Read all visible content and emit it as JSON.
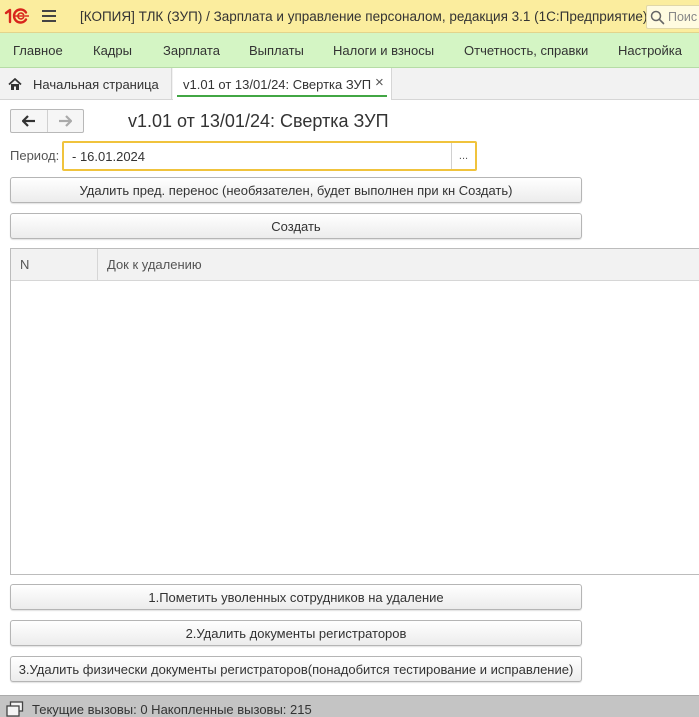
{
  "titlebar": {
    "title": "[КОПИЯ] ТЛК (ЗУП) / Зарплата и управление персоналом, редакция 3.1  (1С:Предприятие)",
    "search_placeholder": "Поис"
  },
  "menu": {
    "items": [
      {
        "label": "Главное"
      },
      {
        "label": "Кадры"
      },
      {
        "label": "Зарплата"
      },
      {
        "label": "Выплаты"
      },
      {
        "label": "Налоги и взносы"
      },
      {
        "label": "Отчетность, справки"
      },
      {
        "label": "Настройка"
      }
    ]
  },
  "tabs": {
    "home_label": "Начальная страница",
    "active_label": "v1.01 от 13/01/24: Свертка ЗУП",
    "close_glyph": "×"
  },
  "form": {
    "title": "v1.01 от 13/01/24: Свертка ЗУП",
    "period_label": "Период:",
    "period_value": "- 16.01.2024",
    "period_choice": "...",
    "btn_remove_transfer": "Удалить пред. перенос (необязателен, будет выполнен при кн Создать)",
    "btn_create": "Создать",
    "table": {
      "columns": [
        "N",
        "Док к удалению"
      ],
      "rows": []
    },
    "btn_mark_dismissed": "1.Пометить уволенных сотрудников на удаление",
    "btn_delete_registrators": "2.Удалить документы регистраторов",
    "btn_delete_physically": "3.Удалить физически документы регистраторов(понадобится тестирование и исправление)"
  },
  "status": {
    "text": "Текущие вызовы: 0   Накопленные вызовы: 215"
  },
  "colors": {
    "titlebar_bg": "#fbed9e",
    "menubar_bg": "#d4f5c4",
    "active_tab_underline": "#42a644",
    "period_field_border": "#f0c33c",
    "logo_red": "#d8251c"
  }
}
